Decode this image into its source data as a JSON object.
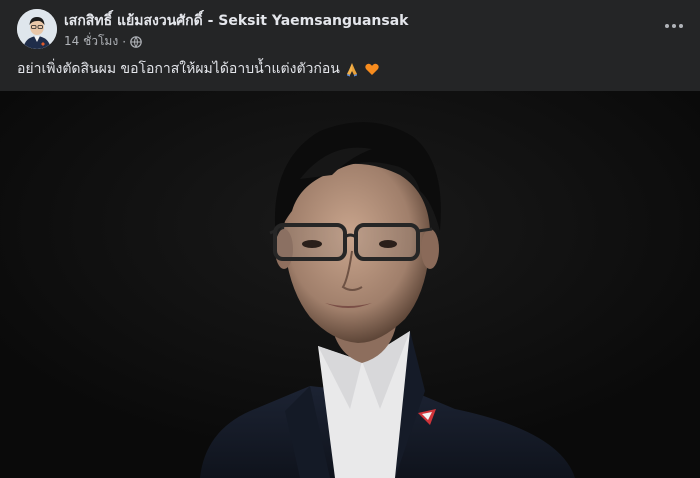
{
  "post": {
    "author_name": "เสกสิทธิ์ แย้มสงวนศักดิ์ - Seksit Yaemsanguansak",
    "timestamp": "14 ชั่วโมง",
    "separator": "·",
    "audience_icon": "globe-icon",
    "more_icon": "more-options-icon",
    "caption": "อย่าเพิ่งตัดสินผม ขอโอกาสให้ผมได้อาบน้ำแต่งตัวก่อน",
    "caption_emojis": [
      "folded-hands-emoji",
      "orange-heart-emoji"
    ],
    "photo": {
      "subject": "man-in-glasses-suit-portrait"
    }
  },
  "colors": {
    "background": "#242526",
    "primary_text": "#e4e6eb",
    "secondary_text": "#b0b3b8",
    "photo_bg": "#0e0e0e",
    "accent_pin": "#d0343a"
  }
}
